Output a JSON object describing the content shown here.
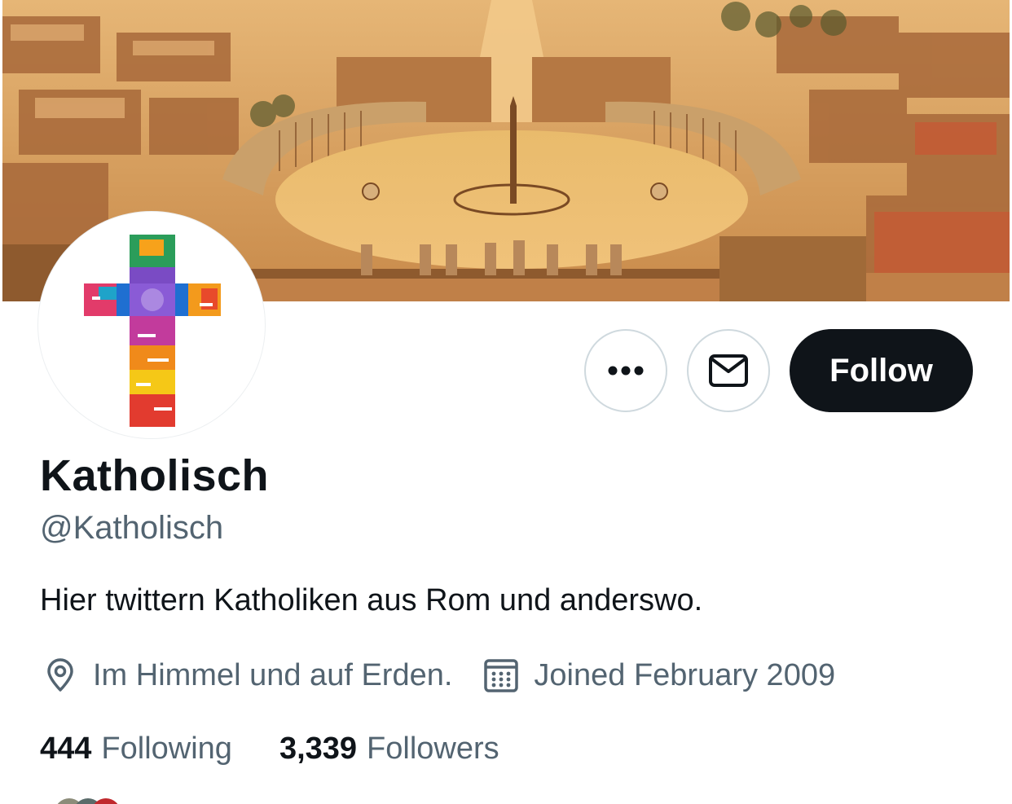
{
  "profile": {
    "name": "Katholisch",
    "handle": "@Katholisch",
    "bio": "Hier twittern Katholiken aus Rom und anderswo.",
    "location": "Im Himmel und auf Erden.",
    "joined": "Joined February 2009"
  },
  "actions": {
    "more_icon": "more-horizontal-icon",
    "mail_icon": "envelope-icon",
    "follow_label": "Follow"
  },
  "stats": {
    "following_count": "444",
    "following_label": "Following",
    "followers_count": "3,339",
    "followers_label": "Followers"
  },
  "colors": {
    "text_primary": "#0f1419",
    "text_secondary": "#536471",
    "button_border": "#cfd9de",
    "follow_bg": "#0f1419"
  }
}
